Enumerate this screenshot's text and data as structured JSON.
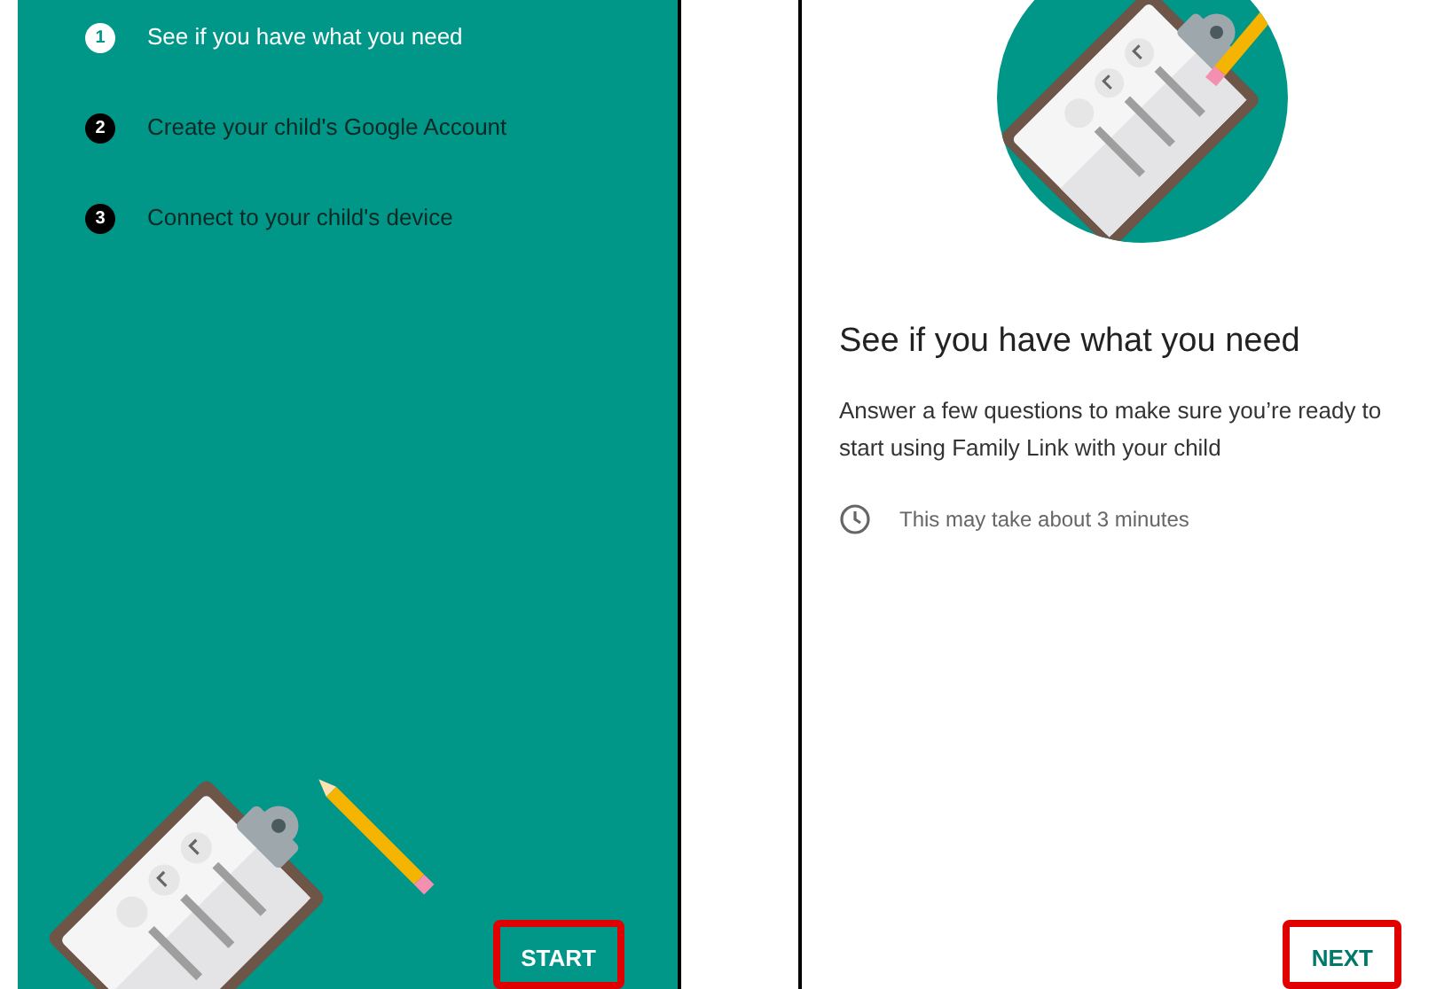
{
  "setup_screen": {
    "steps": [
      {
        "number": "1",
        "label": "See if you have what you need",
        "selected": true
      },
      {
        "number": "2",
        "label": "Create your child's Google Account",
        "selected": false
      },
      {
        "number": "3",
        "label": "Connect to your child's device",
        "selected": false
      }
    ],
    "start_button": {
      "label": "START",
      "highlighted": true
    }
  },
  "check_screen": {
    "title": "See if you have what you need",
    "description": "Answer a few questions to make sure you’re ready to start using Family Link with your child",
    "duration": "This may take about 3 minutes",
    "next_button": {
      "label": "NEXT",
      "highlighted": true
    }
  }
}
